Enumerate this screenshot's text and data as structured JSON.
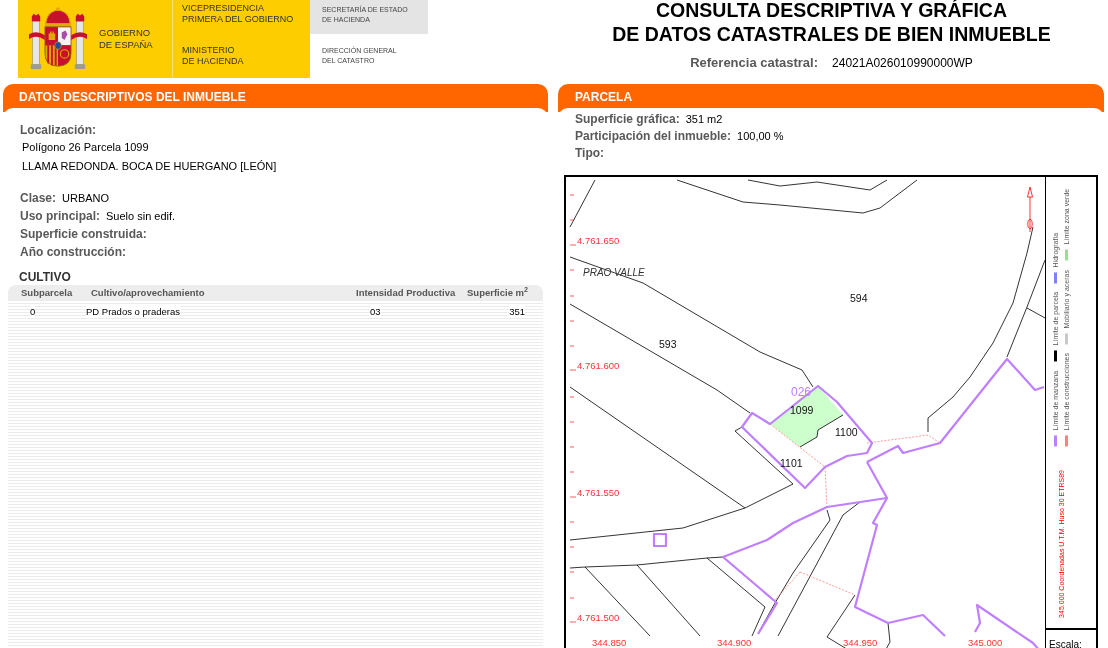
{
  "header": {
    "logo": {
      "government": [
        "GOBIERNO",
        "DE ESPAÑA"
      ],
      "vicepresidency": [
        "VICEPRESIDENCIA",
        "PRIMERA DEL GOBIERNO"
      ],
      "ministry": [
        "MINISTERIO",
        "DE HACIENDA"
      ],
      "secretariat": [
        "SECRETARÍA DE ESTADO",
        "DE HACIENDA"
      ],
      "directorate": [
        "DIRECCIÓN GENERAL",
        "DEL CATASTRO"
      ]
    },
    "title": [
      "CONSULTA DESCRIPTIVA Y GRÁFICA",
      "DE DATOS CATASTRALES DE BIEN INMUEBLE"
    ],
    "reference": {
      "label": "Referencia catastral:",
      "value": "24021A026010990000WP"
    }
  },
  "descriptive_panel": {
    "title": "DATOS DESCRIPTIVOS DEL INMUEBLE",
    "location": {
      "label": "Localización:",
      "lines": [
        "Polígono 26 Parcela 1099",
        "LLAMA REDONDA. BOCA DE HUERGANO [LEÓN]"
      ]
    },
    "fields": [
      {
        "label": "Clase:",
        "value": "URBANO"
      },
      {
        "label": "Uso principal:",
        "value": "Suelo sin edif."
      },
      {
        "label": "Superficie construida:"
      },
      {
        "label": "Año construcción:"
      }
    ],
    "crops": {
      "title": "CULTIVO",
      "columns": [
        "Subparcela",
        "Cultivo/aprovechamiento",
        "Intensidad Productiva",
        "Superficie m$^{2}$"
      ],
      "rows": [
        [
          "0",
          "PD Prados o praderas",
          "03",
          "351"
        ]
      ]
    }
  },
  "parcel_panel": {
    "title": "PARCELA",
    "fields": [
      {
        "label": "Superficie gráfica:",
        "value": "351 m2"
      },
      {
        "label": "Participación del inmueble:",
        "value": "100,00 %"
      },
      {
        "label": "Tipo:"
      }
    ],
    "map": {
      "northing_labels": [
        "4.761.650",
        "4.761.600",
        "4.761.550",
        "4.761.500"
      ],
      "place_name": "PRAO VALLE",
      "parcel_numbers": [
        "594",
        "593",
        "1099",
        "1100",
        "1101"
      ],
      "block_number": "026",
      "easting_labels": [
        "344.850",
        "344.900",
        "344.950",
        "345.000"
      ],
      "legend": [
        {
          "label": "Límite de manzana",
          "color": "#bf7fff"
        },
        {
          "label": "Límite de parcela",
          "color": "#000000"
        },
        {
          "label": "Hidrografía",
          "color": "#8080ff"
        },
        {
          "label": "Límite de construcciones",
          "color": "#ff8080"
        },
        {
          "label": "Mobiliario y aceras",
          "color": "#c8c8c8"
        },
        {
          "label": "Límite zona verde",
          "color": "#99dd99"
        }
      ],
      "coordinates_note": "345.000 Coordenadas U.T.M. Huso 30 ETRS89",
      "scale_label": "Escala:"
    }
  }
}
